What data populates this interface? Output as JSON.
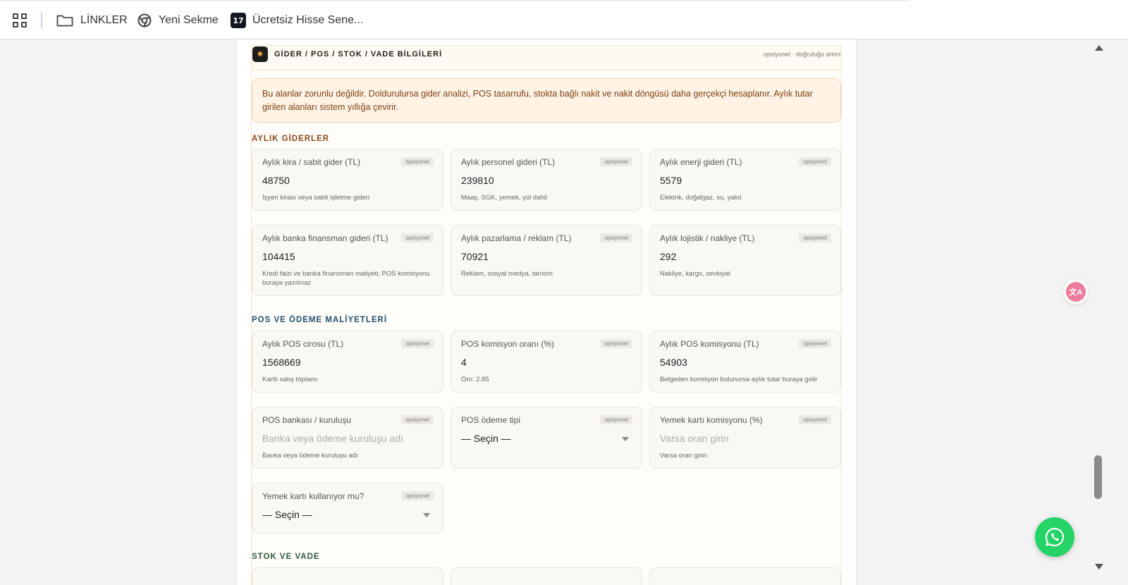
{
  "bookmarks": {
    "items": [
      {
        "label": "LİNKLER",
        "icon": "folder-icon"
      },
      {
        "label": "Yeni Sekme",
        "icon": "chrome-icon"
      },
      {
        "label": "Ücretsiz Hisse Sene...",
        "icon": "tradingview-icon"
      }
    ],
    "tv_logo_text": "17"
  },
  "panel": {
    "title": "GİDER / POS / STOK / VADE BİLGİLERİ",
    "hint": "opsiyonel · doğruluğu artırır",
    "notice": "Bu alanlar zorunlu değildir. Doldurulursa gider analizi, POS tasarrufu, stokta bağlı nakit ve nakit döngüsü daha gerçekçi hesaplanır. Aylık tutar girilen alanları sistem yıllığa çevirir."
  },
  "badge_text": "opsiyonel",
  "sections": {
    "monthly": {
      "title": "AYLIK GİDERLER",
      "color": "#8a4a1a",
      "fields": [
        {
          "label": "Aylık kira / sabit gider (TL)",
          "value": "48750",
          "help": "İşyeri kirası veya sabit işletme gideri"
        },
        {
          "label": "Aylık personel gideri (TL)",
          "value": "239810",
          "help": "Maaş, SGK, yemek, yol dahil"
        },
        {
          "label": "Aylık enerji gideri (TL)",
          "value": "5579",
          "help": "Elektrik, doğalgaz, su, yakıt"
        },
        {
          "label": "Aylık banka finansman gideri (TL)",
          "value": "104415",
          "help": "Kredi faizi ve banka finansman maliyeti; POS komisyonu buraya yazılmaz"
        },
        {
          "label": "Aylık pazarlama / reklam (TL)",
          "value": "70921",
          "help": "Reklam, sosyal medya, tanıtım"
        },
        {
          "label": "Aylık lojistik / nakliye (TL)",
          "value": "292",
          "help": "Nakliye, kargo, sevkiyat"
        }
      ]
    },
    "pos": {
      "title": "POS VE ÖDEME MALİYETLERİ",
      "color": "#1f4f6e",
      "fields": [
        {
          "label": "Aylık POS cirosu (TL)",
          "value": "1568669",
          "help": "Kartlı satış toplamı"
        },
        {
          "label": "POS komisyon oranı (%)",
          "value": "4",
          "help": "Örn: 2.85"
        },
        {
          "label": "Aylık POS komisyonu (TL)",
          "value": "54903",
          "help": "Belgeden komisyon bulunursa aylık tutar buraya gelir"
        },
        {
          "label": "POS bankası / kuruluşu",
          "placeholder": "Banka veya ödeme kuruluşu adı",
          "help": "Banka veya ödeme kuruluşu adı"
        },
        {
          "label": "POS ödeme tipi",
          "selected": "— Seçin —"
        },
        {
          "label": "Yemek kartı komisyonu (%)",
          "placeholder": "Varsa oran girin",
          "help": "Varsa oran girin"
        },
        {
          "label": "Yemek kartı kullanıyor mu?",
          "selected": "— Seçin —"
        }
      ]
    },
    "stock": {
      "title": "STOK VE VADE",
      "color": "#2d5a3a"
    }
  },
  "floating": {
    "translate_icon": "translate-icon",
    "whatsapp_icon": "whatsapp-icon",
    "translate_label": "文A"
  }
}
